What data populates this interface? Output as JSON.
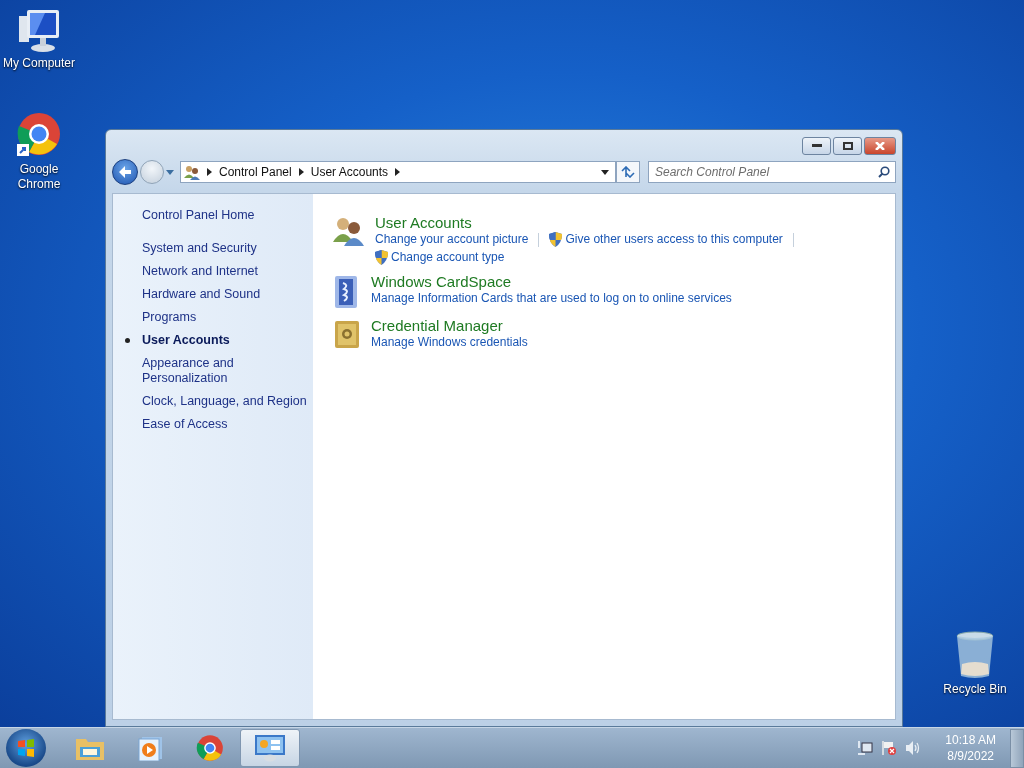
{
  "desktop_icons": [
    {
      "label": "My Computer",
      "kind": "computer"
    },
    {
      "label": "Google\nChrome",
      "kind": "chrome"
    },
    {
      "label": "Recycle Bin",
      "kind": "recycle"
    }
  ],
  "window": {
    "breadcrumb": [
      "Control Panel",
      "User Accounts"
    ],
    "search": {
      "placeholder": "Search Control Panel"
    },
    "sidebar": {
      "home": "Control Panel Home",
      "items": [
        {
          "label": "System and Security",
          "selected": false
        },
        {
          "label": "Network and Internet",
          "selected": false
        },
        {
          "label": "Hardware and Sound",
          "selected": false
        },
        {
          "label": "Programs",
          "selected": false
        },
        {
          "label": "User Accounts",
          "selected": true
        },
        {
          "label": "Appearance and\nPersonalization",
          "selected": false
        },
        {
          "label": "Clock, Language, and Region",
          "selected": false
        },
        {
          "label": "Ease of Access",
          "selected": false
        }
      ]
    },
    "categories": [
      {
        "title": "User Accounts",
        "kind": "users",
        "links": [
          {
            "label": "Change your account picture",
            "shield": false
          },
          {
            "label": "Give other users access to this computer",
            "shield": true
          },
          {
            "label": "Change account type",
            "shield": true
          }
        ]
      },
      {
        "title": "Windows CardSpace",
        "kind": "cardspace",
        "links": [
          {
            "label": "Manage Information Cards that are used to log on to online services",
            "shield": false
          }
        ]
      },
      {
        "title": "Credential Manager",
        "kind": "vault",
        "links": [
          {
            "label": "Manage Windows credentials",
            "shield": false
          }
        ]
      }
    ]
  },
  "taskbar": {
    "apps": [
      {
        "kind": "explorer",
        "selected": false
      },
      {
        "kind": "media",
        "selected": false
      },
      {
        "kind": "chrome",
        "selected": false
      },
      {
        "kind": "control-panel",
        "selected": true
      }
    ],
    "clock": {
      "time": "10:18 AM",
      "date": "8/9/2022"
    }
  }
}
